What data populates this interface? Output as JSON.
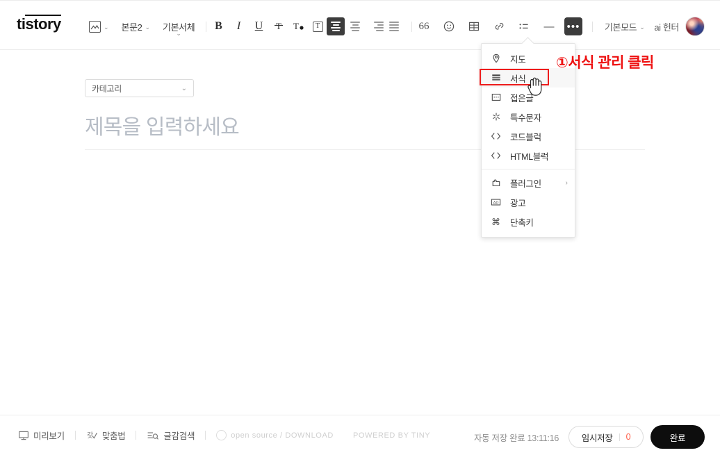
{
  "brand": {
    "logo_pre": "ti",
    "logo_post": "story"
  },
  "toolbar": {
    "image_icon": "image-icon",
    "paragraph_style": "본문2",
    "font_family": "기본서체",
    "bold": "B",
    "italic": "I",
    "underline": "U",
    "strikethrough": "T",
    "text_color": "T",
    "text_box": "T",
    "quote": "66",
    "emoticon": "emoticon-icon",
    "table": "table-icon",
    "link": "link-icon",
    "list": "list-icon",
    "hr": "—",
    "more": "•••",
    "mode": "기본모드"
  },
  "account": {
    "name": "ai 헌터",
    "avatar": "user-avatar"
  },
  "menu": {
    "items": [
      {
        "label": "지도",
        "icon": "map-pin-icon",
        "has_submenu": false,
        "highlighted": false
      },
      {
        "label": "서식",
        "icon": "format-lines-icon",
        "has_submenu": false,
        "highlighted": true
      },
      {
        "label": "접은글",
        "icon": "collapse-icon",
        "has_submenu": false,
        "highlighted": false
      },
      {
        "label": "특수문자",
        "icon": "special-char-icon",
        "has_submenu": false,
        "highlighted": false
      },
      {
        "label": "코드블럭",
        "icon": "code-brackets-icon",
        "has_submenu": false,
        "highlighted": false
      },
      {
        "label": "HTML블럭",
        "icon": "code-brackets-icon",
        "has_submenu": false,
        "highlighted": false
      },
      {
        "label": "플러그인",
        "icon": "plugin-icon",
        "has_submenu": true,
        "submenu_mark": "›",
        "highlighted": false
      },
      {
        "label": "광고",
        "icon": "ad-icon",
        "has_submenu": false,
        "highlighted": false
      },
      {
        "label": "단축키",
        "icon": "command-icon",
        "has_submenu": false,
        "highlighted": false
      }
    ]
  },
  "annotation": {
    "text": "①서식 관리 클릭",
    "color": "#ee1111",
    "highlight_color": "#ee1c1c"
  },
  "editor": {
    "category_label": "카테고리",
    "category_caret": "chevron-down-icon",
    "title_placeholder": "제목을 입력하세요"
  },
  "footer": {
    "preview": "미리보기",
    "spellcheck": "맞춤법",
    "material_search": "글감검색",
    "open_source": "open source / DOWNLOAD",
    "powered_by": "POWERED BY TINY",
    "autosave": "자동 저장 완료 13:11:16",
    "temp_save": "임시저장",
    "temp_count": "0",
    "done": "완료"
  }
}
